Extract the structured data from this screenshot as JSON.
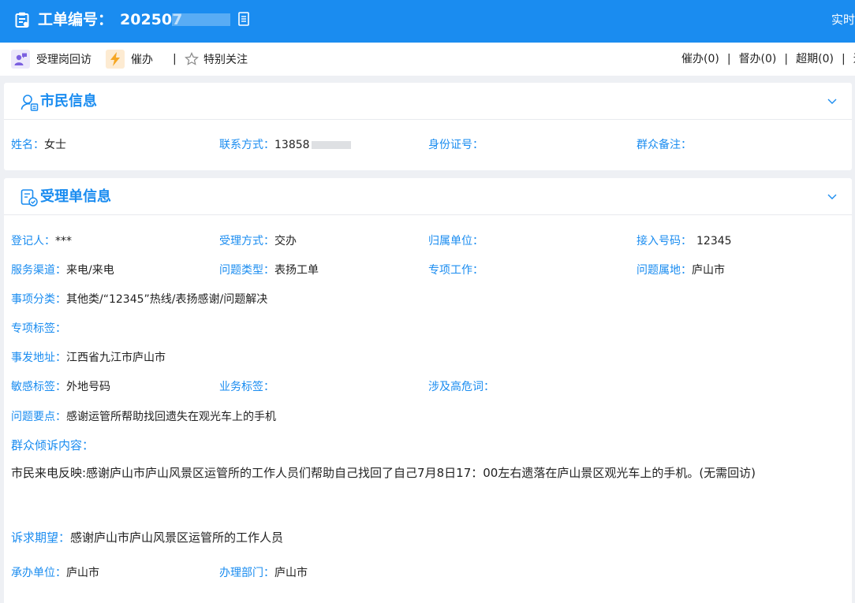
{
  "header": {
    "title_label": "工单编号：",
    "ticket_number": "202507",
    "right_text": "实时"
  },
  "toolbar": {
    "callback_label": "受理岗回访",
    "urge_label": "催办",
    "separator": "|",
    "follow_label": "特别关注",
    "counts": {
      "urge": "催办(0)",
      "supervise": "督办(0)",
      "overdue": "超期(0)",
      "bar": "|",
      "trailing": "退"
    }
  },
  "citizen": {
    "title": "市民信息",
    "name_label": "姓名：",
    "name_value": "女士",
    "contact_label": "联系方式：",
    "contact_value": "13858",
    "id_label": "身份证号：",
    "remark_label": "群众备注："
  },
  "accept": {
    "title": "受理单信息",
    "registrar_label": "登记人：",
    "registrar_value": "***",
    "method_label": "受理方式：",
    "method_value": "交办",
    "unit_label": "归属单位：",
    "access_label": "接入号码：",
    "access_value": "12345",
    "channel_label": "服务渠道：",
    "channel_value": "来电/来电",
    "type_label": "问题类型：",
    "type_value": "表扬工单",
    "special_work_label": "专项工作：",
    "location_label": "问题属地：",
    "location_value": "庐山市",
    "category_label": "事项分类：",
    "category_value": "其他类/“12345”热线/表扬感谢/问题解决",
    "special_tag_label": "专项标签：",
    "address_label": "事发地址：",
    "address_value": "江西省九江市庐山市",
    "sensitive_label": "敏感标签：",
    "sensitive_value": "外地号码",
    "business_tag_label": "业务标签：",
    "risk_label": "涉及高危词：",
    "key_point_label": "问题要点：",
    "key_point_value": "感谢运管所帮助找回遗失在观光车上的手机",
    "complaint_label": "群众倾诉内容：",
    "complaint_value": "市民来电反映:感谢庐山市庐山风景区运管所的工作人员们帮助自己找回了自己7月8日17：00左右遗落在庐山景区观光车上的手机。(无需回访)",
    "expect_label": "诉求期望：",
    "expect_value": "感谢庐山市庐山风景区运管所的工作人员",
    "handler_label": "承办单位：",
    "handler_value": "庐山市",
    "dept_label": "办理部门：",
    "dept_value": "庐山市"
  },
  "colors": {
    "brand_blue": "#1a8cf0",
    "background": "#eef0f4",
    "urge_orange": "#f5a623",
    "callback_purple": "#7b5fe0"
  },
  "icons": [
    "clipboard-icon",
    "copy-icon",
    "callback-person-icon",
    "lightning-icon",
    "star-icon",
    "person-card-icon",
    "form-check-icon",
    "chevron-down-icon"
  ]
}
